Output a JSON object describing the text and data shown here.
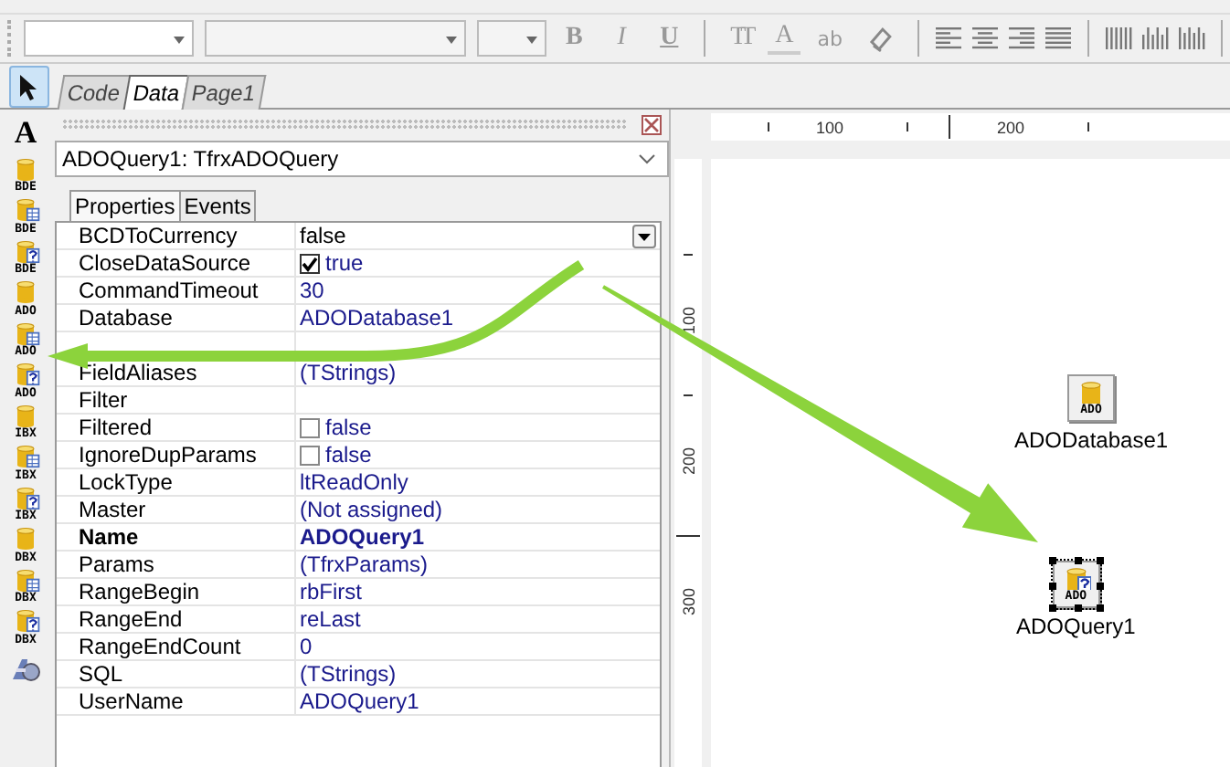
{
  "toolbar": {
    "format_buttons": [
      {
        "label": "B",
        "kind": "bold"
      },
      {
        "label": "I",
        "kind": "italic"
      },
      {
        "label": "U",
        "kind": "underline"
      }
    ],
    "style_buttons": [
      {
        "label": "TT",
        "kind": "size"
      },
      {
        "label": "A",
        "kind": "color"
      },
      {
        "label": "ab",
        "kind": "highlight"
      }
    ]
  },
  "page_tabs": [
    {
      "label": "Code",
      "selected": false
    },
    {
      "label": "Data",
      "selected": true
    },
    {
      "label": "Page1",
      "selected": false
    }
  ],
  "palette": [
    {
      "kind": "pointer",
      "selected": true
    },
    {
      "kind": "text",
      "label": "A",
      "selected": false
    },
    {
      "kind": "table",
      "label": "BDE",
      "selected": false
    },
    {
      "kind": "grid",
      "label": "BDE",
      "selected": false
    },
    {
      "kind": "query",
      "label": "BDE",
      "selected": false
    },
    {
      "kind": "table",
      "label": "ADO",
      "selected": false
    },
    {
      "kind": "grid",
      "label": "ADO",
      "selected": false
    },
    {
      "kind": "query",
      "label": "ADO",
      "selected": false
    },
    {
      "kind": "table",
      "label": "IBX",
      "selected": false
    },
    {
      "kind": "grid",
      "label": "IBX",
      "selected": false
    },
    {
      "kind": "query",
      "label": "IBX",
      "selected": false
    },
    {
      "kind": "table",
      "label": "DBX",
      "selected": false
    },
    {
      "kind": "grid",
      "label": "DBX",
      "selected": false
    },
    {
      "kind": "query",
      "label": "DBX",
      "selected": false
    },
    {
      "kind": "component",
      "selected": false
    }
  ],
  "inspector": {
    "object": "ADOQuery1: TfrxADOQuery",
    "tabs": [
      {
        "label": "Properties",
        "selected": true
      },
      {
        "label": "Events",
        "selected": false
      }
    ],
    "properties": [
      {
        "name": "BCDToCurrency",
        "value": "false",
        "kind": "text",
        "selected": true,
        "bold": false
      },
      {
        "name": "CloseDataSource",
        "value": "true",
        "kind": "checkbox",
        "checked": true,
        "selected": false,
        "bold": false
      },
      {
        "name": "CommandTimeout",
        "value": "30",
        "kind": "text",
        "selected": false,
        "bold": false
      },
      {
        "name": "Database",
        "value": "ADODatabase1",
        "kind": "text",
        "selected": false,
        "bold": false
      },
      {
        "kind": "text"
      },
      {
        "name": "FieldAliases",
        "value": "(TStrings)",
        "kind": "text",
        "selected": false,
        "bold": false
      },
      {
        "name": "Filter",
        "kind": "text",
        "selected": false,
        "bold": false
      },
      {
        "name": "Filtered",
        "value": "false",
        "kind": "checkbox",
        "checked": false,
        "selected": false,
        "bold": false
      },
      {
        "name": "IgnoreDupParams",
        "value": "false",
        "kind": "checkbox",
        "checked": false,
        "selected": false,
        "bold": false
      },
      {
        "name": "LockType",
        "value": "ltReadOnly",
        "kind": "text",
        "selected": false,
        "bold": false
      },
      {
        "name": "Master",
        "value": "(Not assigned)",
        "kind": "text",
        "selected": false,
        "bold": false
      },
      {
        "name": "Name",
        "value": "ADOQuery1",
        "kind": "text",
        "selected": false,
        "bold": true
      },
      {
        "name": "Params",
        "value": "(TfrxParams)",
        "kind": "text",
        "selected": false,
        "bold": false
      },
      {
        "name": "RangeBegin",
        "value": "rbFirst",
        "kind": "text",
        "selected": false,
        "bold": false
      },
      {
        "name": "RangeEnd",
        "value": "reLast",
        "kind": "text",
        "selected": false,
        "bold": false
      },
      {
        "name": "RangeEndCount",
        "value": "0",
        "kind": "text",
        "selected": false,
        "bold": false
      },
      {
        "name": "SQL",
        "value": "(TStrings)",
        "kind": "text",
        "selected": false,
        "bold": false
      },
      {
        "name": "UserName",
        "value": "ADOQuery1",
        "kind": "text",
        "selected": false,
        "bold": false
      }
    ]
  },
  "design": {
    "top_ruler": [
      "100",
      "200"
    ],
    "left_ruler": [
      "100",
      "200",
      "300"
    ],
    "components": [
      {
        "label": "ADODatabase1",
        "kind": "table",
        "icon_label": "ADO",
        "selected": false
      },
      {
        "label": "ADOQuery1",
        "kind": "query",
        "icon_label": "ADO",
        "selected": true
      }
    ]
  }
}
